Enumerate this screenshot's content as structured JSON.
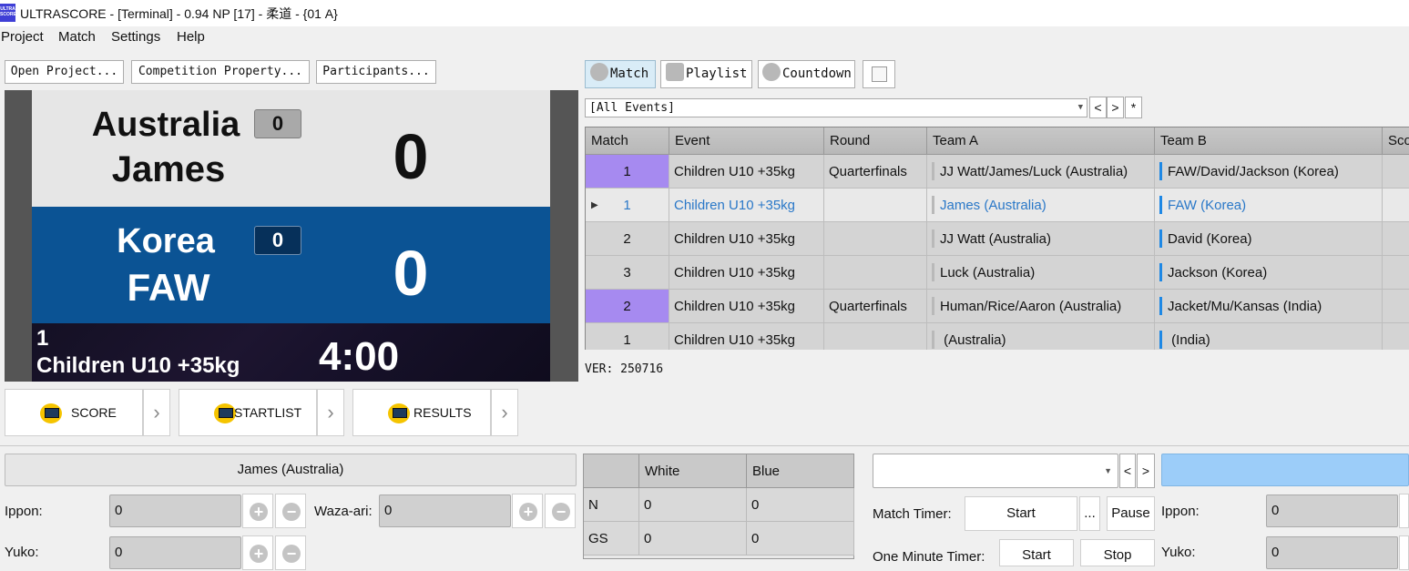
{
  "window": {
    "title": "ULTRASCORE - [Terminal] - 0.94 NP [17] - 柔道 - {01 A}",
    "icon_text": "ULTRA SCORE"
  },
  "menu": [
    "Project",
    "Match",
    "Settings",
    "Help"
  ],
  "left_toolbar": {
    "open_project": "Open Project...",
    "competition_property": "Competition Property...",
    "participants": "Participants..."
  },
  "scoreboard": {
    "white": {
      "country": "Australia",
      "name": "James",
      "penalty": "0",
      "score": "0"
    },
    "blue": {
      "country": "Korea",
      "name": "FAW",
      "penalty": "0",
      "score": "0"
    },
    "match_number": "1",
    "event": "Children U10 +35kg",
    "clock": "4:00"
  },
  "outputs": [
    {
      "label": "SCORE"
    },
    {
      "label": "STARTLIST"
    },
    {
      "label": "RESULTS"
    }
  ],
  "right_toolbar": {
    "match": "Match",
    "playlist": "Playlist",
    "countdown": "Countdown"
  },
  "event_filter": {
    "value": "[All Events]",
    "prev": "<",
    "next": ">",
    "star": "*"
  },
  "grid": {
    "headers": [
      "Match",
      "Event",
      "Round",
      "Team A",
      "Team B",
      "Sco"
    ],
    "rows": [
      {
        "match": "1",
        "event": "Children U10 +35kg",
        "round": "Quarterfinals",
        "team_a": "JJ Watt/James/Luck (Australia)",
        "team_b": "FAW/David/Jackson (Korea)"
      },
      {
        "match": "1",
        "event": "Children U10 +35kg",
        "round": "",
        "team_a": "James (Australia)",
        "team_b": "FAW (Korea)"
      },
      {
        "match": "2",
        "event": "Children U10 +35kg",
        "round": "",
        "team_a": "JJ Watt (Australia)",
        "team_b": "David (Korea)"
      },
      {
        "match": "3",
        "event": "Children U10 +35kg",
        "round": "",
        "team_a": "Luck (Australia)",
        "team_b": "Jackson (Korea)"
      },
      {
        "match": "2",
        "event": "Children U10 +35kg",
        "round": "Quarterfinals",
        "team_a": "Human/Rice/Aaron (Australia)",
        "team_b": "Jacket/Mu/Kansas (India)"
      },
      {
        "match": "1",
        "event": "Children U10 +35kg",
        "round": "",
        "team_a": " (Australia)",
        "team_b": " (India)"
      }
    ]
  },
  "version": "VER: 250716",
  "white_panel": {
    "header": "James (Australia)",
    "ippon_label": "Ippon:",
    "ippon_value": "0",
    "waza_ari_label": "Waza-ari:",
    "waza_ari_value": "0",
    "yuko_label": "Yuko:",
    "yuko_value": "0"
  },
  "penalty_table": {
    "headers": [
      "",
      "White",
      "Blue"
    ],
    "rows": [
      {
        "label": "N",
        "white": "0",
        "blue": "0"
      },
      {
        "label": "GS",
        "white": "0",
        "blue": "0"
      }
    ]
  },
  "timer_panel": {
    "select_value": "",
    "prev": "<",
    "next": ">",
    "match_timer_label": "Match Timer:",
    "start": "Start",
    "more": "...",
    "pause": "Pause",
    "one_minute_label": "One Minute Timer:",
    "start2": "Start",
    "stop": "Stop"
  },
  "blue_panel": {
    "ippon_label": "Ippon:",
    "ippon_value": "0",
    "yuko_label": "Yuko:",
    "yuko_value": "0"
  },
  "colors": {
    "accent_blue": "#0b5394",
    "purple_row": "#a68af0",
    "selected_text": "#2a78c8",
    "blue_header": "#9ccdf9"
  }
}
